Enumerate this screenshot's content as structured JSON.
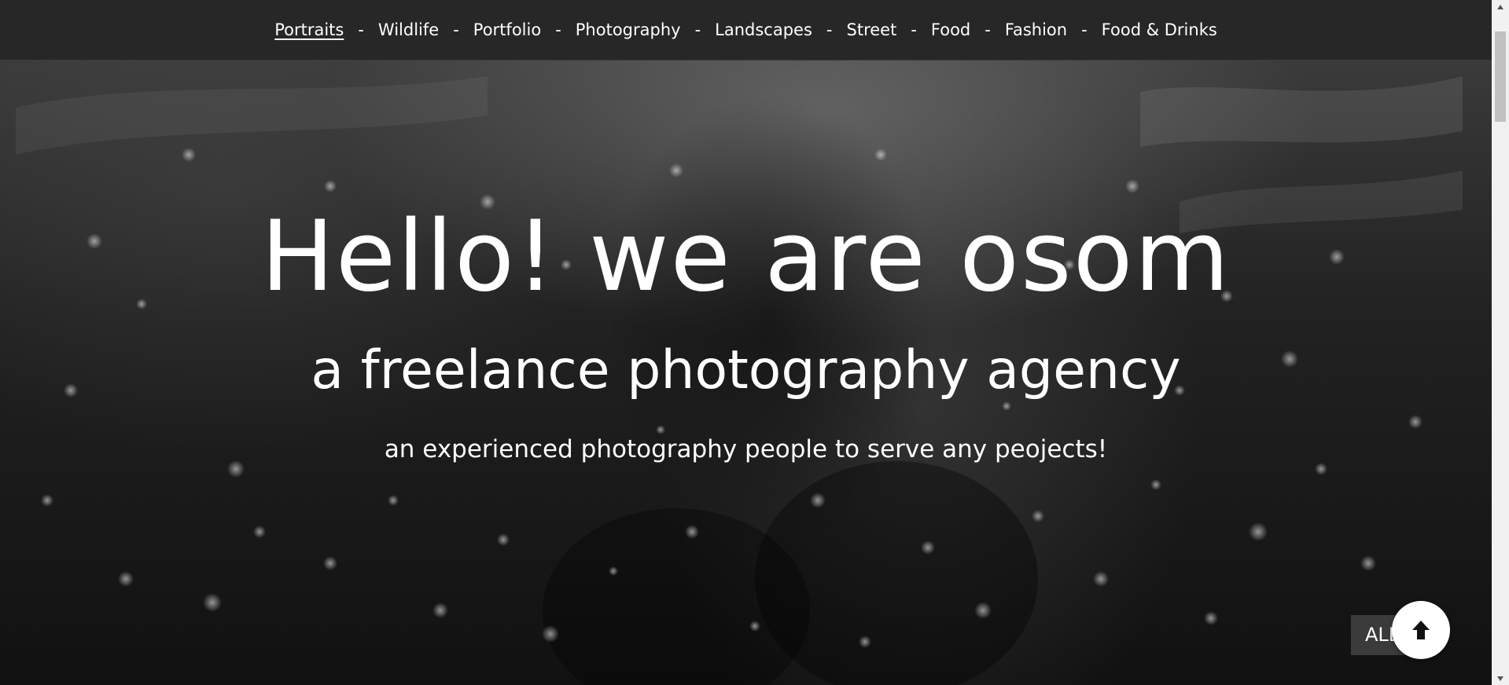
{
  "nav": {
    "items": [
      {
        "label": "Portraits",
        "active": true
      },
      {
        "label": "Wildlife"
      },
      {
        "label": "Portfolio"
      },
      {
        "label": "Photography"
      },
      {
        "label": "Landscapes"
      },
      {
        "label": "Street"
      },
      {
        "label": "Food"
      },
      {
        "label": "Fashion"
      },
      {
        "label": "Food & Drinks"
      }
    ],
    "separator": "-"
  },
  "hero": {
    "title": "Hello! we are osom",
    "subtitle": "a freelance photography agency",
    "tagline": "an experienced photography people to serve any peojects!"
  },
  "buttons": {
    "all_label": "ALL",
    "scroll_top_icon": "arrow-up-icon"
  },
  "colors": {
    "nav_background": "#272727",
    "text": "#ffffff",
    "scroll_top_background": "#ffffff",
    "all_background": "#3b3b3b"
  }
}
